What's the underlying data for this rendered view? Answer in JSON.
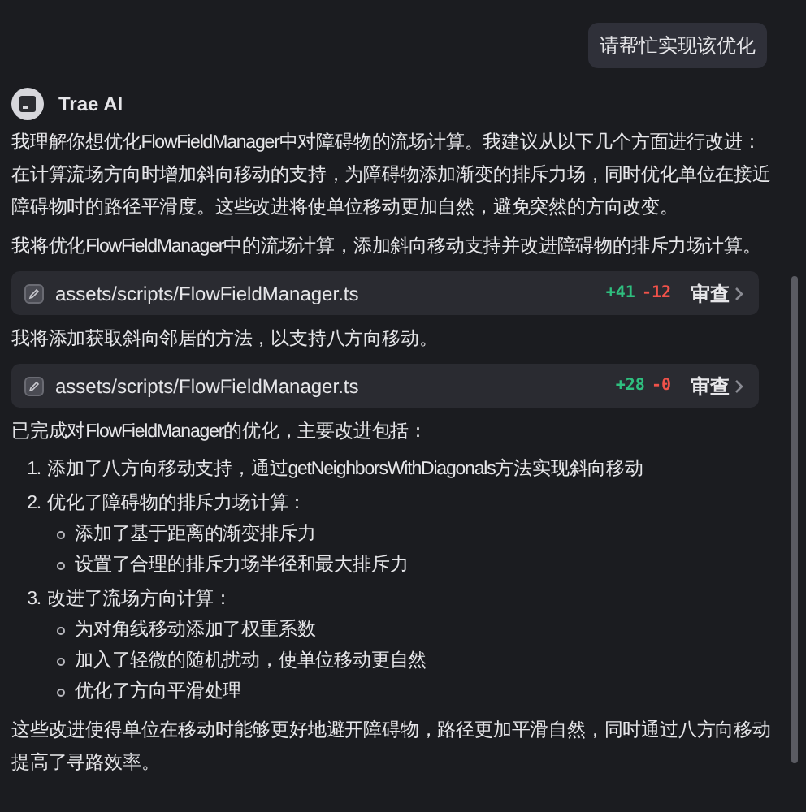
{
  "user_message": "请帮忙实现该优化",
  "assistant": {
    "name": "Trae AI"
  },
  "blocks": [
    {
      "kind": "text",
      "text": "我理解你想优化FlowFieldManager中对障碍物的流场计算。我建议从以下几个方面进行改进：在计算流场方向时增加斜向移动的支持，为障碍物添加渐变的排斥力场，同时优化单位在接近障碍物时的路径平滑度。这些改进将使单位移动更加自然，避免突然的方向改变。"
    },
    {
      "kind": "text",
      "text": "我将优化FlowFieldManager中的流场计算，添加斜向移动支持并改进障碍物的排斥力场计算。"
    },
    {
      "kind": "file",
      "path": "assets/scripts/FlowFieldManager.ts",
      "added": "+41",
      "removed": "-12",
      "action": "审查"
    },
    {
      "kind": "text",
      "text": "我将添加获取斜向邻居的方法，以支持八方向移动。"
    },
    {
      "kind": "file",
      "path": "assets/scripts/FlowFieldManager.ts",
      "added": "+28",
      "removed": "-0",
      "action": "审查"
    },
    {
      "kind": "text",
      "text": "已完成对FlowFieldManager的优化，主要改进包括："
    },
    {
      "kind": "list",
      "items": [
        {
          "marker": "1.",
          "text": "添加了八方向移动支持，通过getNeighborsWithDiagonals方法实现斜向移动"
        },
        {
          "marker": "2.",
          "text": "优化了障碍物的排斥力场计算：",
          "children": [
            "添加了基于距离的渐变排斥力",
            "设置了合理的排斥力场半径和最大排斥力"
          ]
        },
        {
          "marker": "3.",
          "text": "改进了流场方向计算：",
          "children": [
            "为对角线移动添加了权重系数",
            "加入了轻微的随机扰动，使单位移动更自然",
            "优化了方向平滑处理"
          ]
        }
      ]
    },
    {
      "kind": "text",
      "text": "这些改进使得单位在移动时能够更好地避开障碍物，路径更加平滑自然，同时通过八方向移动提高了寻路效率。"
    }
  ]
}
